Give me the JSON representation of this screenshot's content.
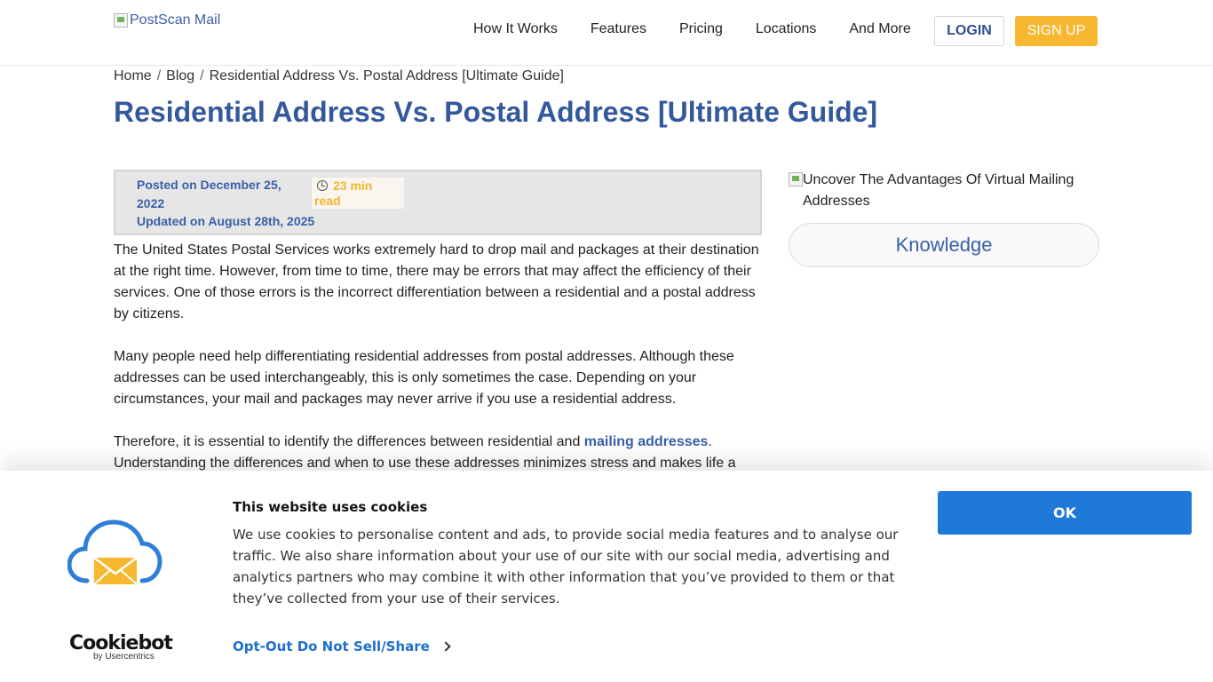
{
  "header": {
    "logo_alt": "PostScan Mail",
    "nav": [
      "How It Works",
      "Features",
      "Pricing",
      "Locations",
      "And More"
    ],
    "login_label": "LOGIN",
    "signup_label": "SIGN UP",
    "colors": {
      "brand_blue": "#34589c",
      "signup_orange": "#f7b731"
    }
  },
  "breadcrumb": {
    "items": [
      "Home",
      "Blog",
      "Residential Address Vs. Postal Address [Ultimate Guide]"
    ],
    "separator": "/"
  },
  "page_title": "Residential Address Vs. Postal Address [Ultimate Guide]",
  "meta": {
    "posted": "Posted on December 25, 2022",
    "read_time": "23 min read",
    "updated": "Updated on August 28th, 2025"
  },
  "article": {
    "p1": "The United States Postal Services works extremely hard to drop mail and packages at their destination at the right time. However, from time to time, there may be errors that may affect the efficiency of their services. One of those errors is the incorrect differentiation between a residential and a postal address by citizens.",
    "p2": "Many people need help differentiating residential addresses from postal addresses. Although these addresses can be used interchangeably, this is only sometimes the case. Depending on your circumstances, your mail and packages may never arrive if you use a residential address.",
    "p3_before": "Therefore, it is essential to identify the differences between residential and ",
    "p3_link": "mailing addresses",
    "p3_after": ". Understanding the differences and when to use these addresses minimizes stress and makes life a"
  },
  "sidebar": {
    "image_alt": "Uncover The Advantages Of Virtual Mailing Addresses",
    "category_label": "Knowledge"
  },
  "cookie_banner": {
    "title": "This website uses cookies",
    "text": "We use cookies to personalise content and ads, to provide social media features and to analyse our traffic. We also share information about your use of our site with our social media, advertising and analytics partners who may combine it with other information that you’ve provided to them or that they’ve collected from your use of their services.",
    "ok_label": "OK",
    "optout_label": "Opt-Out Do Not Sell/Share",
    "brand_name": "Cookiebot",
    "brand_sub": "by Usercentrics",
    "colors": {
      "ok_button": "#1f79d8",
      "link_blue": "#1e6fcf"
    }
  }
}
